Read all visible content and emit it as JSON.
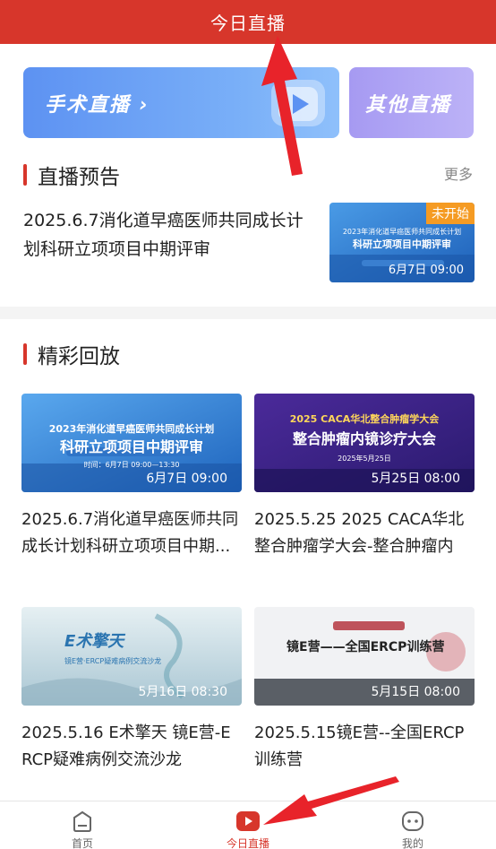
{
  "header": {
    "title": "今日直播"
  },
  "banners": {
    "surgery": {
      "label": "手术直播 ›"
    },
    "other": {
      "label": "其他直播"
    }
  },
  "preview": {
    "section_title": "直播预告",
    "more": "更多",
    "item": {
      "title": "2025.6.7消化道早癌医师共同成长计划科研立项项目中期评审",
      "badge": "未开始",
      "time": "6月7日 09:00",
      "thumb_text_line1": "2023年消化道早癌医师共同成长计划",
      "thumb_text_line2": "科研立项项目中期评审"
    }
  },
  "replay": {
    "section_title": "精彩回放",
    "cards": [
      {
        "title": "2025.6.7消化道早癌医师共同成长计划科研立项项目中期...",
        "time": "6月7日 09:00",
        "thumb_line1": "2023年消化道早癌医师共同成长计划",
        "thumb_line2": "科研立项项目中期评审",
        "thumb_line3": "时间：6月7日 09:00—13:30"
      },
      {
        "title": "2025.5.25 2025 CACA华北整合肿瘤学大会-整合肿瘤内镜...",
        "time": "5月25日 08:00",
        "thumb_line1": "2025 CACA华北整合肿瘤学大会",
        "thumb_line2": "整合肿瘤内镜诊疗大会",
        "thumb_line3": "2025年5月25日"
      },
      {
        "title": "2025.5.16 E术擎天 镜E营-ERCP疑难病例交流沙龙",
        "time": "5月16日 08:30",
        "thumb_line1": "E术擎天",
        "thumb_line2": "镜E营·ERCP疑难病例交流沙龙",
        "thumb_line3": ""
      },
      {
        "title": "2025.5.15镜E营--全国ERCP训练营",
        "time": "5月15日 08:00",
        "thumb_line1": "镜E营——全国ERCP训练营",
        "thumb_line2": "",
        "thumb_line3": ""
      }
    ]
  },
  "nav": {
    "items": [
      {
        "label": "首页"
      },
      {
        "label": "今日直播"
      },
      {
        "label": "我的"
      }
    ]
  },
  "colors": {
    "brand": "#d7362b",
    "badge": "#f59b23",
    "annotation_arrow": "#e8232a"
  }
}
